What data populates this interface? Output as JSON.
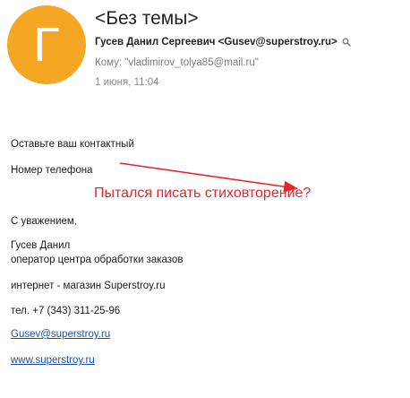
{
  "header": {
    "avatar_letter": "Г",
    "avatar_color": "#f5a623",
    "subject": "<Без темы>",
    "sender_name": "Гусев Данил Сергеевич",
    "sender_email": "<Gusev@superstroy.ru>",
    "to_label": "Кому:",
    "to_value": "\"vladimirov_tolya85@mail.ru\"",
    "date": "1 июня, 11:04"
  },
  "body": {
    "line1": "Оставьте ваш контактный",
    "line2": "Номер телефона",
    "regards": "С уважением,",
    "name": "Гусев Данил",
    "position": "оператор центра обработки заказов",
    "shop": "интернет - магазин Superstroy.ru",
    "phone": "тел. +7 (343) 311-25-96",
    "email_link": "Gusev@superstroy.ru",
    "site_link": "www.superstroy.ru"
  },
  "annotation": {
    "text": "Пытался писать стиховторение?",
    "color": "#e5262b"
  }
}
